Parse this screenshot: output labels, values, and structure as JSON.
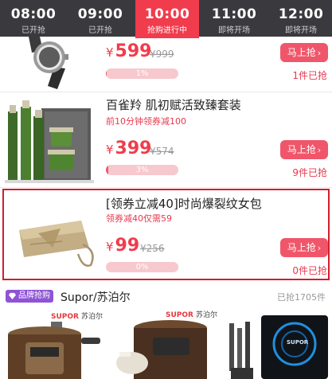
{
  "tabs": [
    {
      "time": "08:00",
      "status": "已开抢"
    },
    {
      "time": "09:00",
      "status": "已开抢"
    },
    {
      "time": "10:00",
      "status": "抢购进行中"
    },
    {
      "time": "11:00",
      "status": "即将开场"
    },
    {
      "time": "12:00",
      "status": "即将开场"
    }
  ],
  "products": [
    {
      "title": "",
      "subtitle": "",
      "currency": "¥",
      "price": "599",
      "old_price": "¥999",
      "progress_pct": 1,
      "progress_label": "1%",
      "buy_label": "马上抢",
      "sold": "1件已抢"
    },
    {
      "title": "百雀羚 肌初赋活致臻套装",
      "subtitle": "前10分钟领券减100",
      "currency": "¥",
      "price": "399",
      "old_price": "¥574",
      "progress_pct": 3,
      "progress_label": "3%",
      "buy_label": "马上抢",
      "sold": "9件已抢"
    },
    {
      "title": "[领券立减40]时尚爆裂纹女包",
      "subtitle": "领券减40仅需59",
      "currency": "¥",
      "price": "99",
      "old_price": "¥256",
      "progress_pct": 0,
      "progress_label": "0%",
      "buy_label": "马上抢",
      "sold": "0件已抢"
    }
  ],
  "brand_section": {
    "badge": "品牌抢购",
    "name": "Supor/苏泊尔",
    "sold": "已抢1705件",
    "logo_en": "SUPOR",
    "logo_cn": "苏泊尔",
    "tile_logo": "SUPOR"
  },
  "colors": {
    "accent": "#f03c4c",
    "tab_bar": "#3a3a3e",
    "badge": "#8e54d6",
    "highlight": "#d01e2e"
  }
}
